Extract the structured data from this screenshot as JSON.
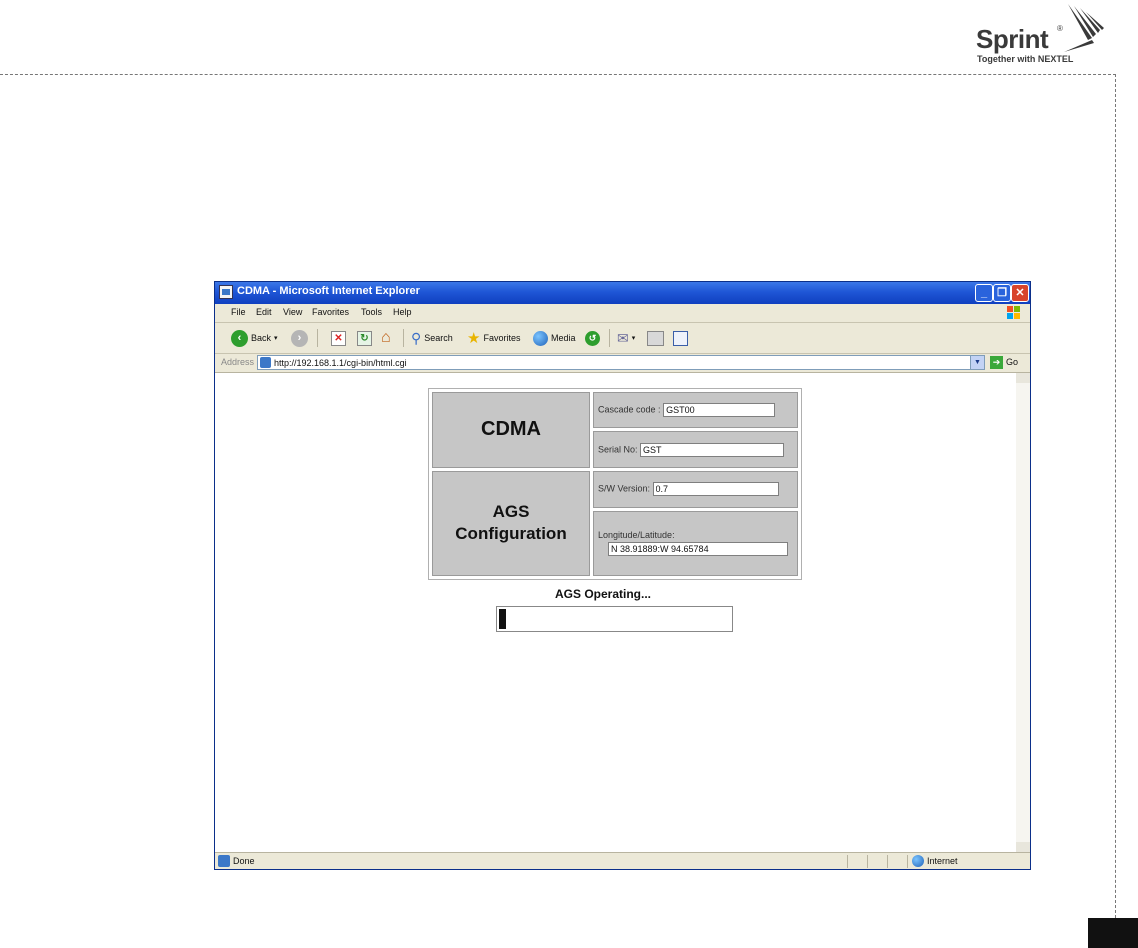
{
  "brand": {
    "name": "Sprint",
    "registered": "®",
    "tagline": "Together with NEXTEL"
  },
  "window": {
    "title": "CDMA - Microsoft Internet Explorer",
    "minimize": "_",
    "maximize": "❐",
    "close": "✕"
  },
  "menu": {
    "items": [
      "File",
      "Edit",
      "View",
      "Favorites",
      "Tools",
      "Help"
    ]
  },
  "toolbar": {
    "back": "Back",
    "search": "Search",
    "favorites": "Favorites",
    "media": "Media"
  },
  "address": {
    "label": "Address",
    "url": "http://192.168.1.1/cgi-bin/html.cgi",
    "go": "Go"
  },
  "config": {
    "system": "CDMA",
    "section_line1": "AGS",
    "section_line2": "Configuration",
    "cascade_label": "Cascade code :",
    "cascade_value": "GST00",
    "serial_label": "Serial No:",
    "serial_value": "GST",
    "sw_label": "S/W Version:",
    "sw_value": "0.7",
    "location_label": "Longitude/Latitude:",
    "location_value": "N 38.91889:W 94.65784"
  },
  "operation": {
    "title": "AGS Operating...",
    "progress_percent": 3
  },
  "status": {
    "text": "Done",
    "zone": "Internet"
  },
  "colors": {
    "title_bar": "#1f56d6",
    "cell_gray": "#c6c6c6",
    "progress_fill": "#111111"
  }
}
